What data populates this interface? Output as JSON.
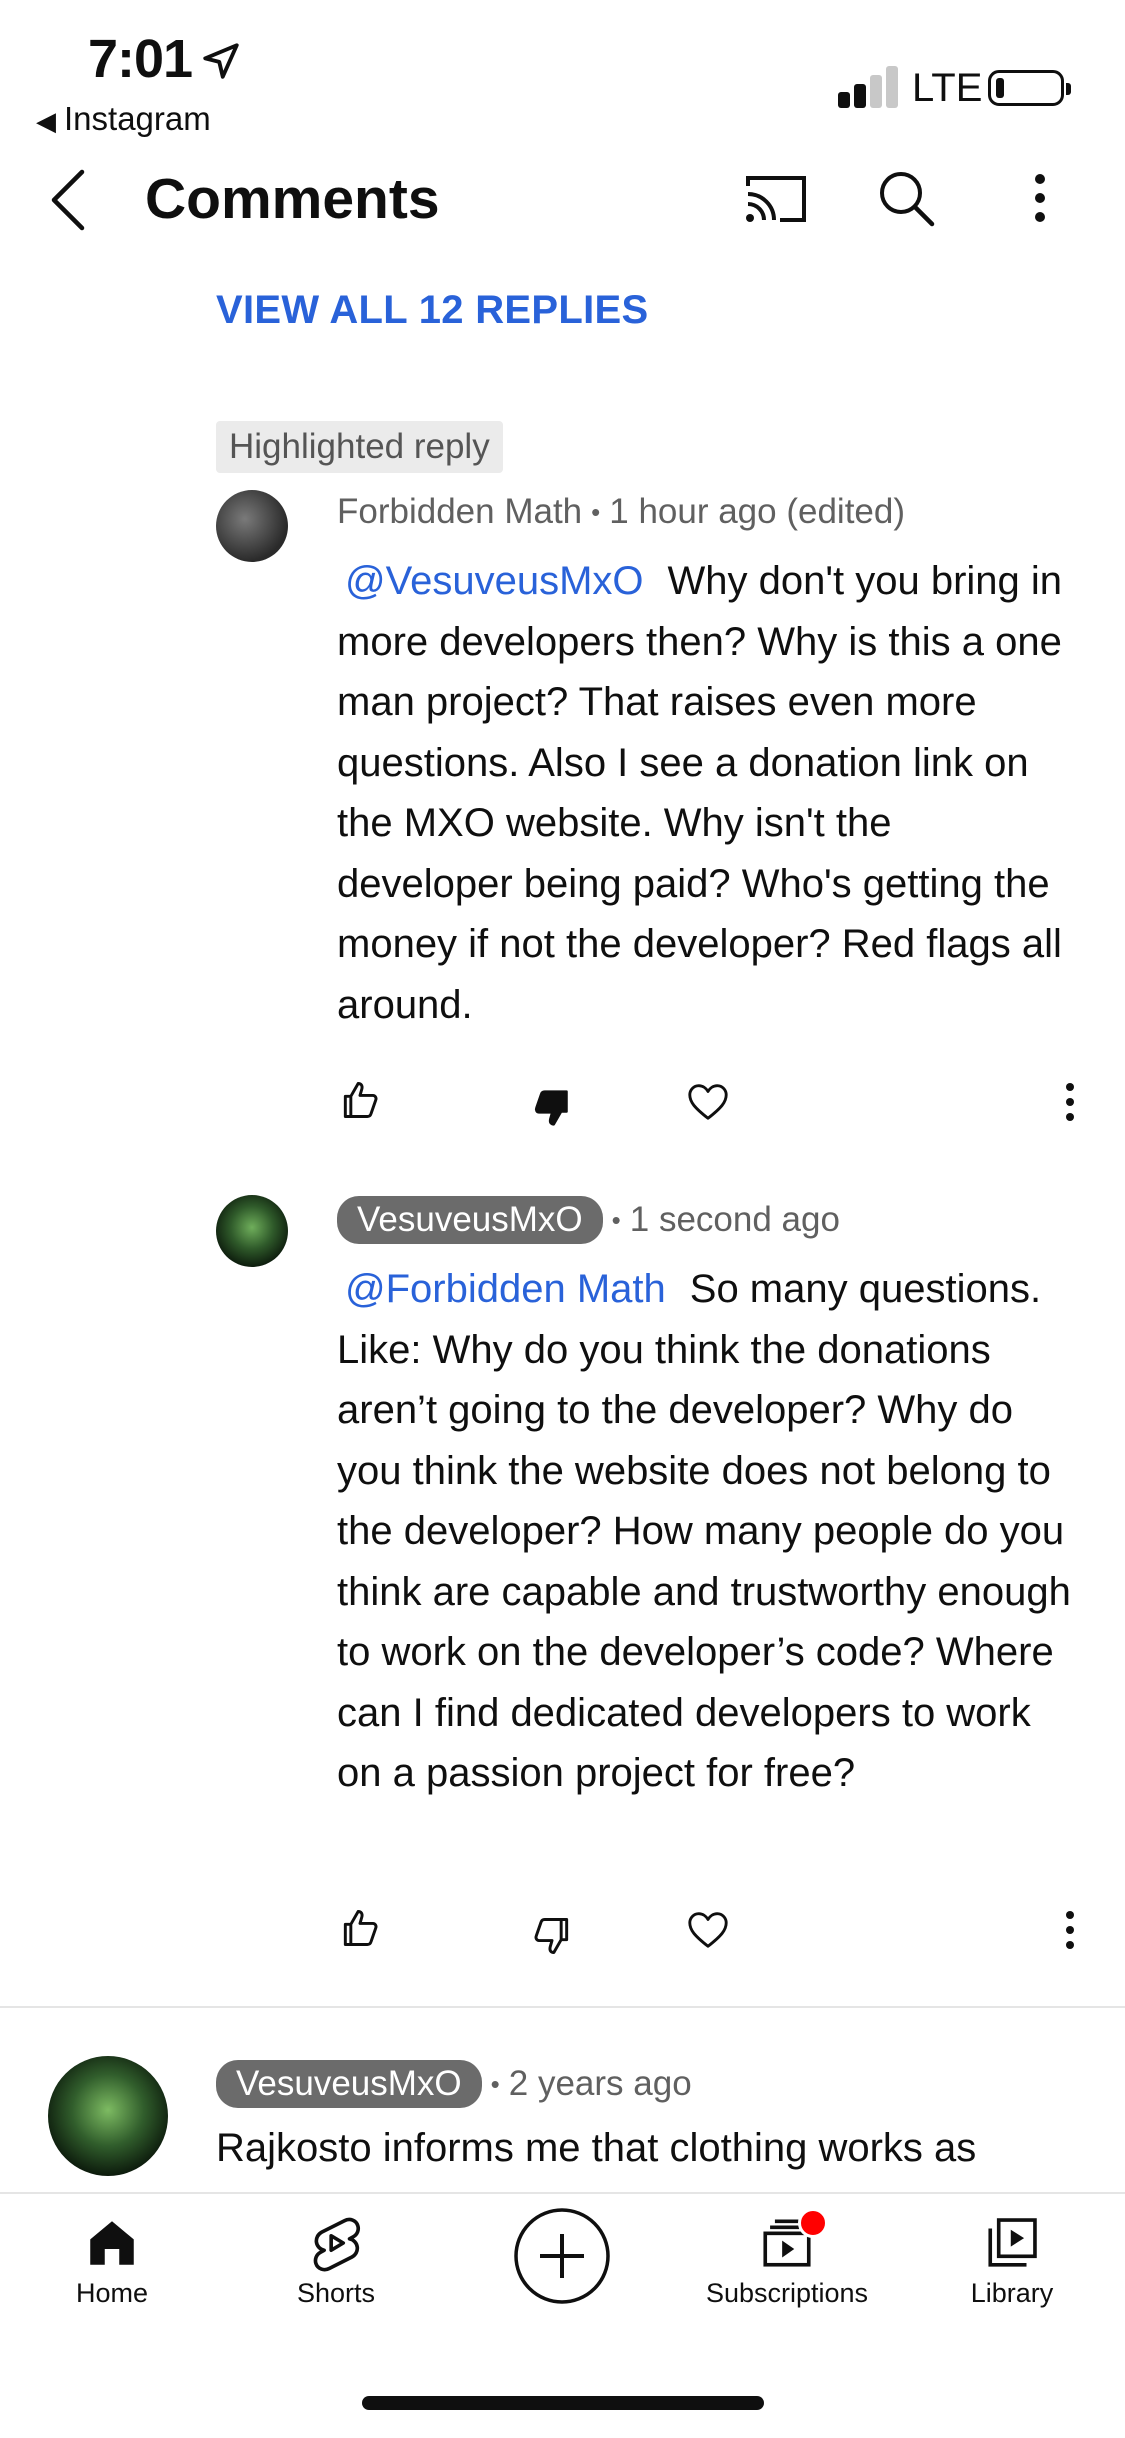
{
  "status_bar": {
    "time": "7:01",
    "back_app": "Instagram",
    "network": "LTE"
  },
  "header": {
    "title": "Comments"
  },
  "view_all_replies": "VIEW ALL 12 REPLIES",
  "highlighted_label": "Highlighted reply",
  "comments": [
    {
      "author": "Forbidden Math",
      "time": "1 hour ago (edited)",
      "mention": "@VesuveusMxO",
      "text": "Why don't you bring in more developers then? Why is this a one man project? That raises even more questions. Also I see a donation link on the MXO website. Why isn't the developer being paid? Who's getting the money if not the developer? Red flags all around.",
      "disliked": true
    },
    {
      "author": "VesuveusMxO",
      "time": "1 second ago",
      "mention": "@Forbidden Math",
      "text": "So many questions. Like: Why do you think the donations aren’t going to the developer? Why do you think the website does not belong to the developer? How many people do you think are capable and trustworthy enough to work on the developer’s code? Where can I find dedicated developers to work on a passion project for free?",
      "disliked": false
    }
  ],
  "next_comment": {
    "author": "VesuveusMxO",
    "time": "2 years ago",
    "text": "Rajkosto informs me that clothing works as"
  },
  "bottom_nav": [
    {
      "label": "Home",
      "icon": "home-icon",
      "active": true
    },
    {
      "label": "Shorts",
      "icon": "shorts-icon"
    },
    {
      "label": "",
      "icon": "create-icon"
    },
    {
      "label": "Subscriptions",
      "icon": "subscriptions-icon",
      "badge_color": "#ff0000"
    },
    {
      "label": "Library",
      "icon": "library-icon"
    }
  ],
  "colors": {
    "link": "#2962d9",
    "pill": "#6b6b6b",
    "badge": "#ff0000"
  }
}
